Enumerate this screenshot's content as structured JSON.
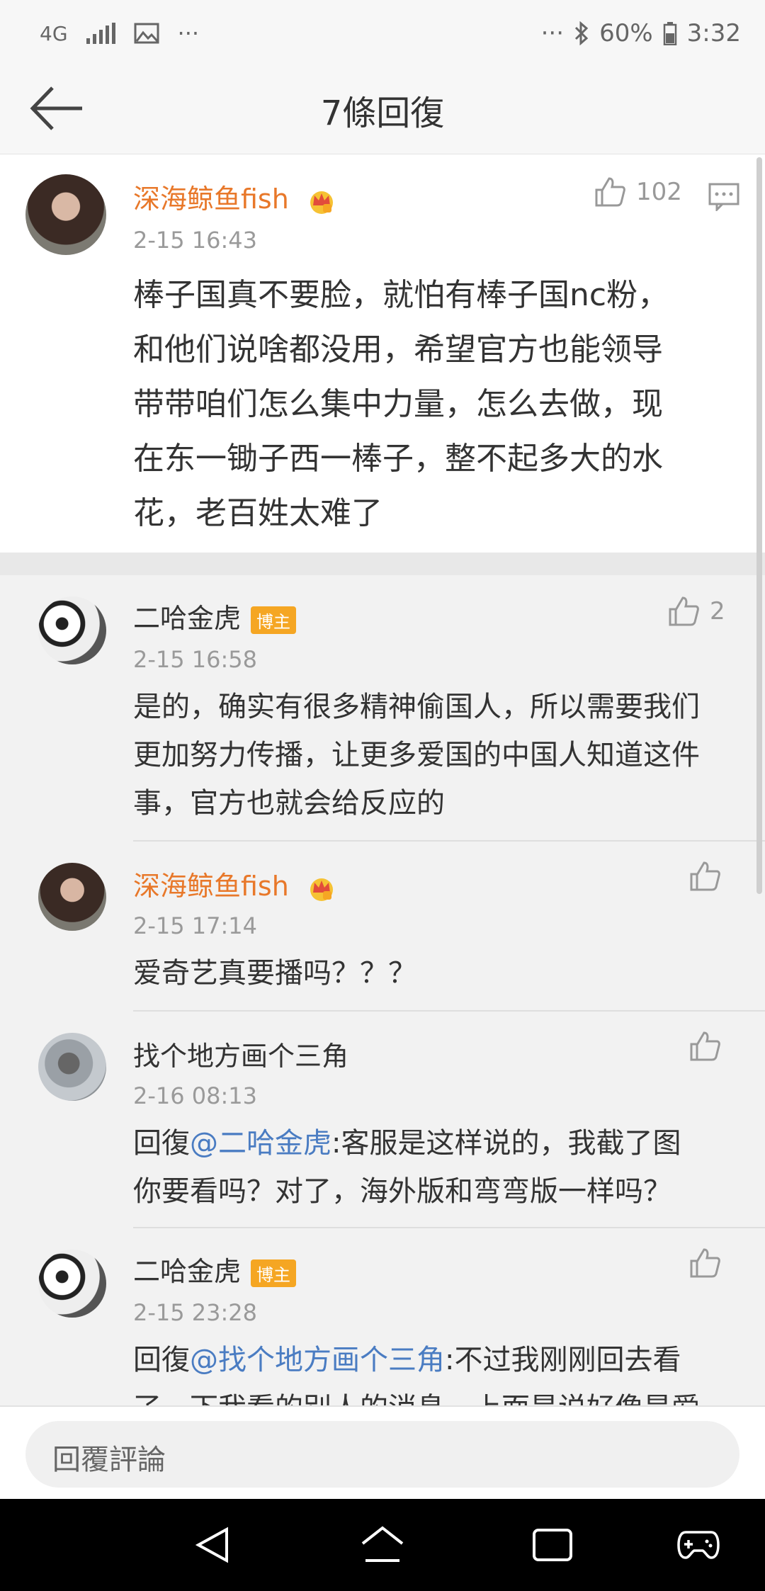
{
  "status_bar": {
    "network": "4G",
    "more_left": "···",
    "more_right": "···",
    "battery": "60%",
    "time": "3:32"
  },
  "header": {
    "title": "7條回復"
  },
  "main_comment": {
    "username": "深海鲸鱼fish",
    "time": "2-15 16:43",
    "likes": "102",
    "lines": [
      "棒子国真不要脸，就怕有棒子国nc粉，",
      "和他们说啥都没用，希望官方也能领导",
      "带带咱们怎么集中力量，怎么去做，现",
      "在东一锄子西一棒子，整不起多大的水",
      "花，老百姓太难了"
    ]
  },
  "replies": [
    {
      "username": "二哈金虎",
      "badge": "博主",
      "time": "2-15 16:58",
      "likes": "2",
      "lines": [
        "是的，确实有很多精神偷国人，所以需要我们",
        "更加努力传播，让更多爱国的中国人知道这件",
        "事，官方也就会给反应的"
      ]
    },
    {
      "username": "深海鲸鱼fish",
      "time": "2-15 17:14",
      "lines": [
        "爱奇艺真要播吗？？？"
      ]
    },
    {
      "username": "找个地方画个三角",
      "time": "2-16 08:13",
      "reply_prefix": "回復",
      "mention": "@二哈金虎",
      "lines": [
        ":客服是这样说的，我截了图",
        "你要看吗？对了，海外版和弯弯版一样吗？"
      ]
    },
    {
      "username": "二哈金虎",
      "badge": "博主",
      "time": "2-15 23:28",
      "reply_prefix": "回復",
      "mention": "@找个地方画个三角",
      "lines": [
        ":不过我刚刚回去看",
        "了一下我看的别人的消息，上面是说好像是爱"
      ]
    }
  ],
  "input": {
    "placeholder": "回覆評論"
  },
  "colors": {
    "username_orange": "#e8782a",
    "mention_blue": "#4a7cc2",
    "badge_orange": "#f5a623"
  }
}
